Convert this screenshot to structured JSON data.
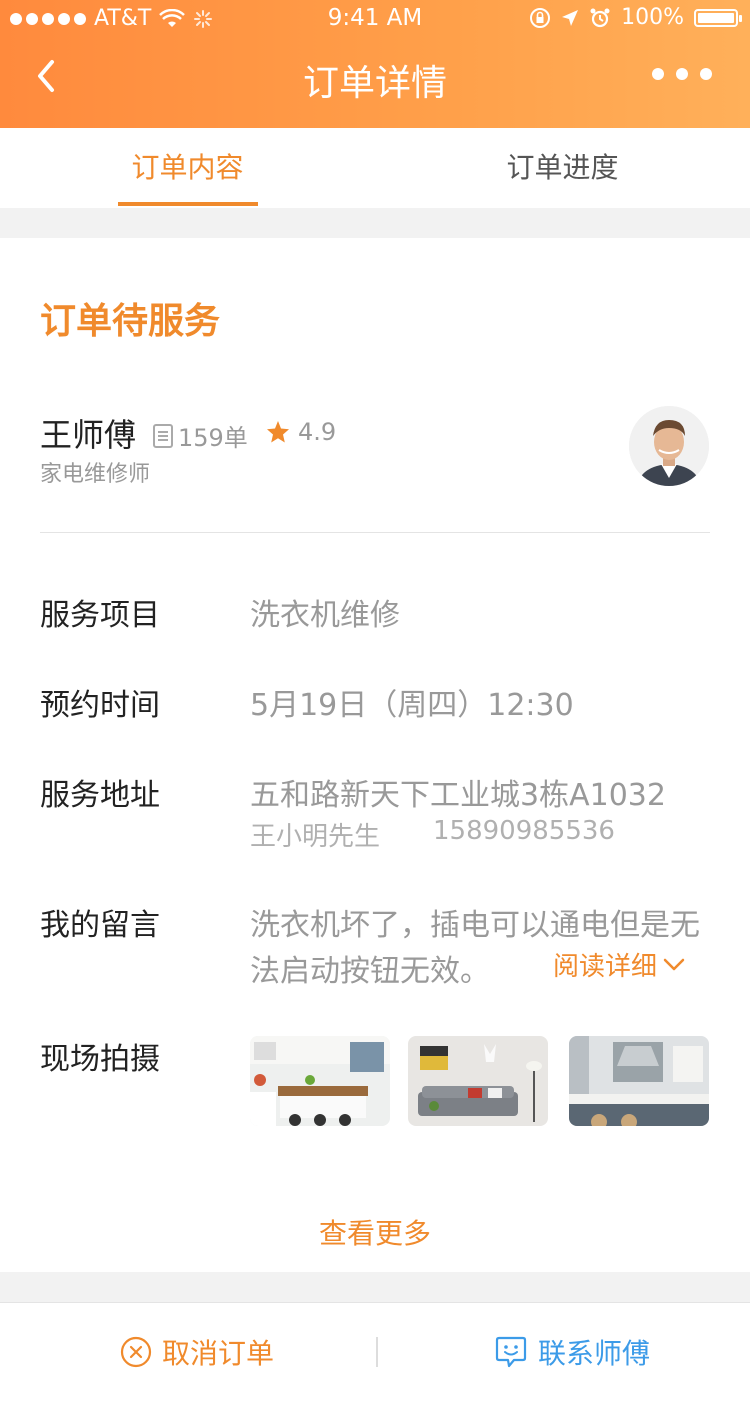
{
  "status_bar": {
    "carrier": "AT&T",
    "time": "9:41 AM",
    "battery": "100%"
  },
  "nav": {
    "title": "订单详情"
  },
  "tabs": [
    {
      "label": "订单内容",
      "active": true
    },
    {
      "label": "订单进度",
      "active": false
    }
  ],
  "order": {
    "status": "订单待服务",
    "technician": {
      "name": "王师傅",
      "orders": "159单",
      "rating": "4.9",
      "role": "家电维修师"
    },
    "rows": {
      "service_label": "服务项目",
      "service_value": "洗衣机维修",
      "time_label": "预约时间",
      "time_value": "5月19日（周四）12:30",
      "address_label": "服务地址",
      "address_value": "五和路新天下工业城3栋A1032",
      "contact_name": "王小明先生",
      "contact_phone": "15890985536",
      "message_label": "我的留言",
      "message_line1": "洗衣机坏了，插电可以通电但是无",
      "message_line2": "法启动按钮无效。",
      "read_more": "阅读详细",
      "photos_label": "现场拍摄"
    },
    "see_more": "查看更多"
  },
  "actions": {
    "cancel": "取消订单",
    "contact": "联系师傅"
  },
  "colors": {
    "accent": "#f08a2c",
    "link_blue": "#3c9be8",
    "header_start": "#ff8a3d",
    "header_end": "#ffb05a"
  }
}
